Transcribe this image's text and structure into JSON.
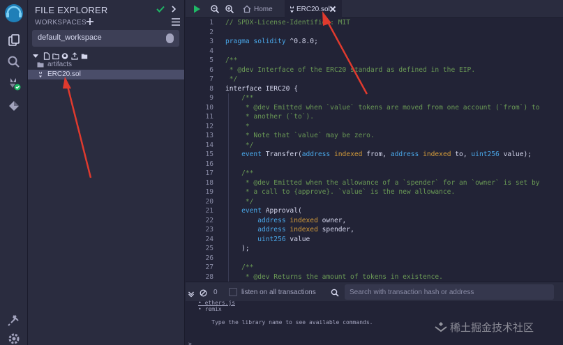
{
  "side_panel": {
    "title": "FILE EXPLORER",
    "workspaces_label": "WORKSPACES",
    "workspace_selected": "default_workspace",
    "tree": [
      {
        "name": "artifacts",
        "kind": "folder"
      },
      {
        "name": "ERC20.sol",
        "kind": "file",
        "selected": true
      }
    ]
  },
  "tabs": [
    {
      "label": "Home",
      "icon": "home-icon",
      "active": false
    },
    {
      "label": "ERC20.sol",
      "icon": "solidity-icon",
      "active": true
    }
  ],
  "code": [
    [
      {
        "t": "// SPDX-License-Identifier: MIT",
        "c": "com"
      }
    ],
    [],
    [
      {
        "t": "pragma solidity ",
        "c": "kw"
      },
      {
        "t": "^0.8.0;",
        "c": "txt"
      }
    ],
    [],
    [
      {
        "t": "/**",
        "c": "com"
      }
    ],
    [
      {
        "t": " * @dev Interface of the ERC20 standard as defined in the EIP.",
        "c": "com"
      }
    ],
    [
      {
        "t": " */",
        "c": "com"
      }
    ],
    [
      {
        "t": "interface IERC20 {",
        "c": "txt"
      }
    ],
    [
      {
        "t": "    /**",
        "c": "com"
      }
    ],
    [
      {
        "t": "     * @dev Emitted when `value` tokens are moved from one account (`from`) to",
        "c": "com"
      }
    ],
    [
      {
        "t": "     * another (`to`).",
        "c": "com"
      }
    ],
    [
      {
        "t": "     *",
        "c": "com"
      }
    ],
    [
      {
        "t": "     * Note that `value` may be zero.",
        "c": "com"
      }
    ],
    [
      {
        "t": "     */",
        "c": "com"
      }
    ],
    [
      {
        "t": "    event ",
        "c": "kw"
      },
      {
        "t": "Transfer(",
        "c": "txt"
      },
      {
        "t": "address ",
        "c": "kw"
      },
      {
        "t": "indexed ",
        "c": "kw2"
      },
      {
        "t": "from, ",
        "c": "txt"
      },
      {
        "t": "address ",
        "c": "kw"
      },
      {
        "t": "indexed ",
        "c": "kw2"
      },
      {
        "t": "to, ",
        "c": "txt"
      },
      {
        "t": "uint256 ",
        "c": "kw"
      },
      {
        "t": "value);",
        "c": "txt"
      }
    ],
    [],
    [
      {
        "t": "    /**",
        "c": "com"
      }
    ],
    [
      {
        "t": "     * @dev Emitted when the allowance of a `spender` for an `owner` is set by",
        "c": "com"
      }
    ],
    [
      {
        "t": "     * a call to {approve}. `value` is the new allowance.",
        "c": "com"
      }
    ],
    [
      {
        "t": "     */",
        "c": "com"
      }
    ],
    [
      {
        "t": "    event ",
        "c": "kw"
      },
      {
        "t": "Approval(",
        "c": "txt"
      }
    ],
    [
      {
        "t": "        address ",
        "c": "kw"
      },
      {
        "t": "indexed ",
        "c": "kw2"
      },
      {
        "t": "owner,",
        "c": "txt"
      }
    ],
    [
      {
        "t": "        address ",
        "c": "kw"
      },
      {
        "t": "indexed ",
        "c": "kw2"
      },
      {
        "t": "spender,",
        "c": "txt"
      }
    ],
    [
      {
        "t": "        uint256 ",
        "c": "kw"
      },
      {
        "t": "value",
        "c": "txt"
      }
    ],
    [
      {
        "t": "    );",
        "c": "txt"
      }
    ],
    [],
    [
      {
        "t": "    /**",
        "c": "com"
      }
    ],
    [
      {
        "t": "     * @dev Returns the amount of tokens in existence.",
        "c": "com"
      }
    ]
  ],
  "terminal_bar": {
    "count": "0",
    "listen_label": "listen on all transactions",
    "search_placeholder": "Search with transaction hash or address"
  },
  "terminal": {
    "lines": [
      "• ethers.js",
      "• remix",
      "",
      "    Type the library name to see available commands."
    ],
    "prompt": ">"
  },
  "watermark": "稀土掘金技术社区",
  "colors": {
    "background": "#222336",
    "panel": "#2a2c3f",
    "accent": "#4aa8ea",
    "success": "#1fb866",
    "annotation_arrow": "#e03a2e"
  }
}
